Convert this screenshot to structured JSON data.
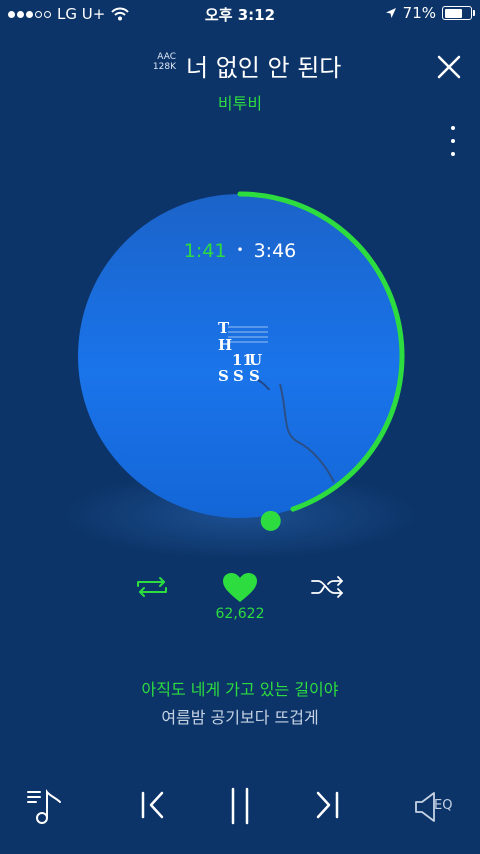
{
  "status_bar": {
    "carrier": "LG U+",
    "time": "오후 3:12",
    "battery": "71%",
    "battery_level": 0.71
  },
  "track": {
    "codec_line1": "AAC",
    "codec_line2": "128K",
    "title": "너 없인 안 된다",
    "artist": "비투비"
  },
  "playback": {
    "elapsed": "1:41",
    "separator": "•",
    "total": "3:46",
    "progress": 0.447
  },
  "actions": {
    "like_count": "62,622"
  },
  "lyrics": {
    "current": "아직도 네게 가고 있는 길이야",
    "next": "여름밤 공기보다 뜨겁게"
  },
  "controls": {
    "eq_label": "EQ"
  },
  "colors": {
    "background": "#0c3468",
    "accent": "#2ddd3f",
    "disc": "#1a6fe0"
  },
  "icons": [
    "wifi-icon",
    "location-arrow-icon",
    "battery-icon",
    "close-icon",
    "more-vertical-icon",
    "repeat-icon",
    "heart-icon",
    "shuffle-icon",
    "playlist-icon",
    "previous-icon",
    "pause-icon",
    "next-icon",
    "equalizer-icon"
  ]
}
